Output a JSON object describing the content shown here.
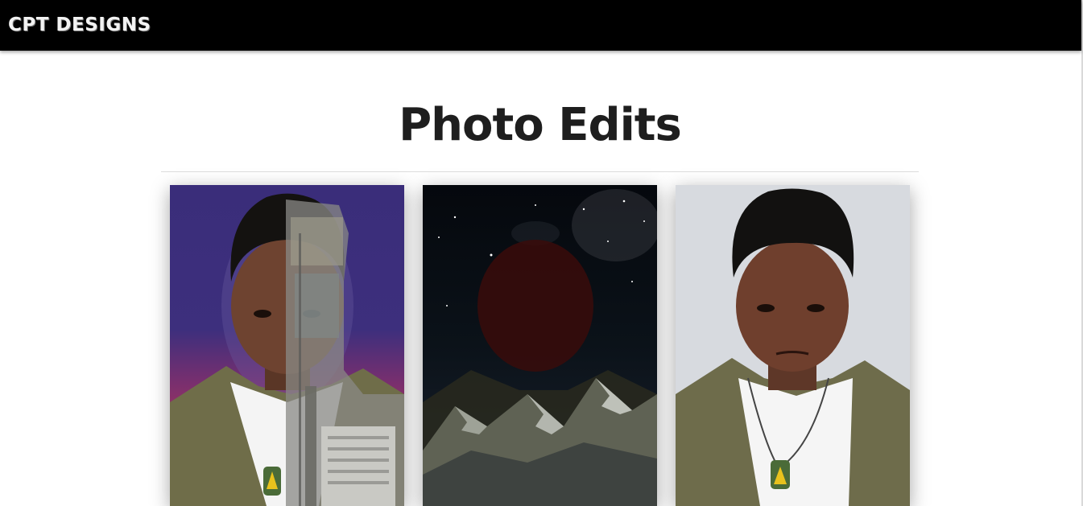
{
  "navbar": {
    "brand": "CPT DESIGNS",
    "background": "#000000"
  },
  "main": {
    "title": "Photo Edits"
  },
  "gallery": {
    "items": [
      {
        "image": "portrait-city-split-edit"
      },
      {
        "image": "portrait-night-sky-mountain-edit"
      },
      {
        "image": "portrait-illustrated-edit"
      }
    ]
  }
}
